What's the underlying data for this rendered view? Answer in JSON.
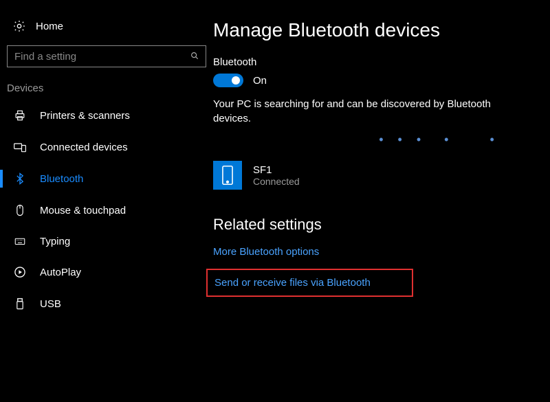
{
  "sidebar": {
    "home_label": "Home",
    "search_placeholder": "Find a setting",
    "section_header": "Devices",
    "items": [
      {
        "label": "Printers & scanners",
        "icon": "printer-icon",
        "active": false
      },
      {
        "label": "Connected devices",
        "icon": "connected-devices-icon",
        "active": false
      },
      {
        "label": "Bluetooth",
        "icon": "bluetooth-icon",
        "active": true
      },
      {
        "label": "Mouse & touchpad",
        "icon": "mouse-icon",
        "active": false
      },
      {
        "label": "Typing",
        "icon": "keyboard-icon",
        "active": false
      },
      {
        "label": "AutoPlay",
        "icon": "autoplay-icon",
        "active": false
      },
      {
        "label": "USB",
        "icon": "usb-icon",
        "active": false
      }
    ]
  },
  "main": {
    "title": "Manage Bluetooth devices",
    "bluetooth_label": "Bluetooth",
    "toggle_on": true,
    "toggle_text": "On",
    "status_text": "Your PC is searching for and can be discovered by Bluetooth devices.",
    "device": {
      "name": "SF1",
      "status": "Connected"
    },
    "related_title": "Related settings",
    "links": {
      "more_options": "More Bluetooth options",
      "send_receive": "Send or receive files via Bluetooth"
    }
  }
}
